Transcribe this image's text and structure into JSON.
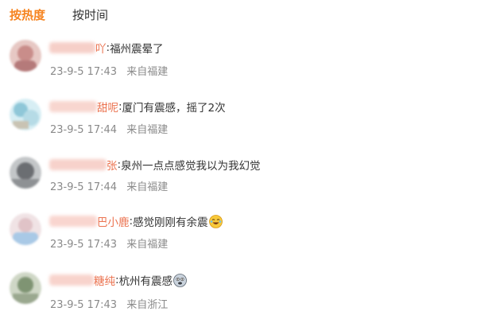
{
  "tabs": [
    {
      "label": "按热度",
      "active": true
    },
    {
      "label": "按时间",
      "active": false
    }
  ],
  "comments": [
    {
      "username_visible": "吖",
      "text": "福州震晕了",
      "time": "23-9-5 17:43",
      "location": "来自福建",
      "avatar_colors": [
        "#c98d8a",
        "#e7c8c4"
      ],
      "name_blur_color": "#f6cfc8"
    },
    {
      "username_visible": "甜呢",
      "text": "厦门有震感，摇了2次",
      "time": "23-9-5 17:44",
      "location": "来自福建",
      "avatar_colors": [
        "#8fc7d8",
        "#d7eef4"
      ],
      "name_blur_color": "#f8d6cf"
    },
    {
      "username_visible": "张",
      "text": "泉州一点点感觉我以为我幻觉",
      "time": "23-9-5 17:44",
      "location": "来自福建",
      "avatar_colors": [
        "#6b6e72",
        "#c3c6c8"
      ],
      "name_blur_color": "#f7d2cb"
    },
    {
      "username_visible": "巴小鹿",
      "text": "感觉刚刚有余震",
      "emoji": "laugh-cry-emoji",
      "time": "23-9-5 17:43",
      "location": "来自福建",
      "avatar_colors": [
        "#e0c3c7",
        "#a9c9e6"
      ],
      "name_blur_color": "#f9d5cf"
    },
    {
      "username_visible": "糖纯",
      "text": "杭州有震感",
      "emoji": "scared-emoji",
      "time": "23-9-5 17:43",
      "location": "来自浙江",
      "avatar_colors": [
        "#7f9473",
        "#cfd7c6"
      ],
      "name_blur_color": "#f8d3cc"
    }
  ]
}
